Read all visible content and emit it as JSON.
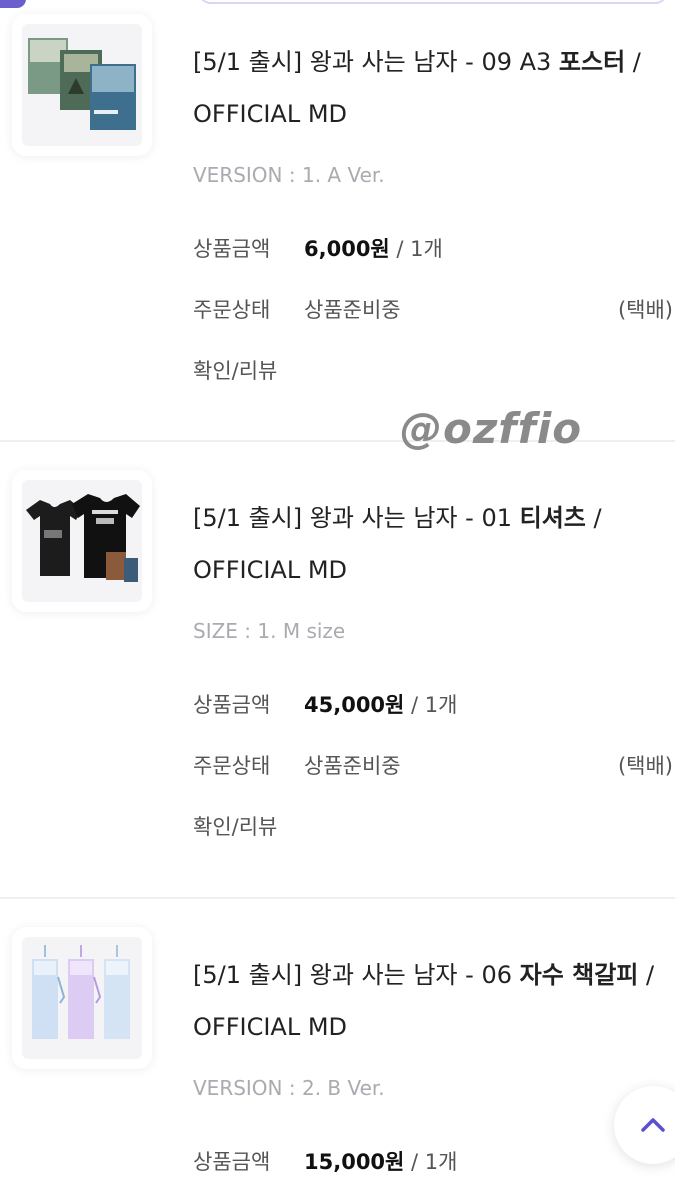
{
  "items": [
    {
      "title_prefix": "[5/1 출시] 왕과 사는 남자 - ",
      "title_num": "09 A3 ",
      "title_name": "포스터",
      "title_suffix": " / OFFICIAL MD",
      "option": "VERSION : 1. A Ver.",
      "price_label": "상품금액",
      "price": "6,000원",
      "qty": " / 1개",
      "status_label": "주문상태",
      "status": "상품준비중",
      "shipping": "(택배)",
      "review": "확인/리뷰",
      "thumb_icon": "poster-thumbnail"
    },
    {
      "title_prefix": "[5/1 출시] 왕과 사는 남자 - ",
      "title_num": "01 ",
      "title_name": "티셔츠",
      "title_suffix": " / OFFICIAL MD",
      "option": "SIZE : 1. M size",
      "price_label": "상품금액",
      "price": "45,000원",
      "qty": " / 1개",
      "status_label": "주문상태",
      "status": "상품준비중",
      "shipping": "(택배)",
      "review": "확인/리뷰",
      "thumb_icon": "tshirt-thumbnail"
    },
    {
      "title_prefix": "[5/1 출시] 왕과 사는 남자 - ",
      "title_num": "06 ",
      "title_name": "자수 책갈피",
      "title_suffix": " / OFFICIAL MD",
      "option": "VERSION : 2. B Ver.",
      "price_label": "상품금액",
      "price": "15,000원",
      "qty": " / 1개",
      "thumb_icon": "bookmark-thumbnail"
    }
  ],
  "watermark": "@ozffio",
  "scroll_top_icon": "chevron-up-icon",
  "colors": {
    "accent": "#5b4fcf",
    "divider": "#eeeef4",
    "option_text": "#aaaab0"
  }
}
